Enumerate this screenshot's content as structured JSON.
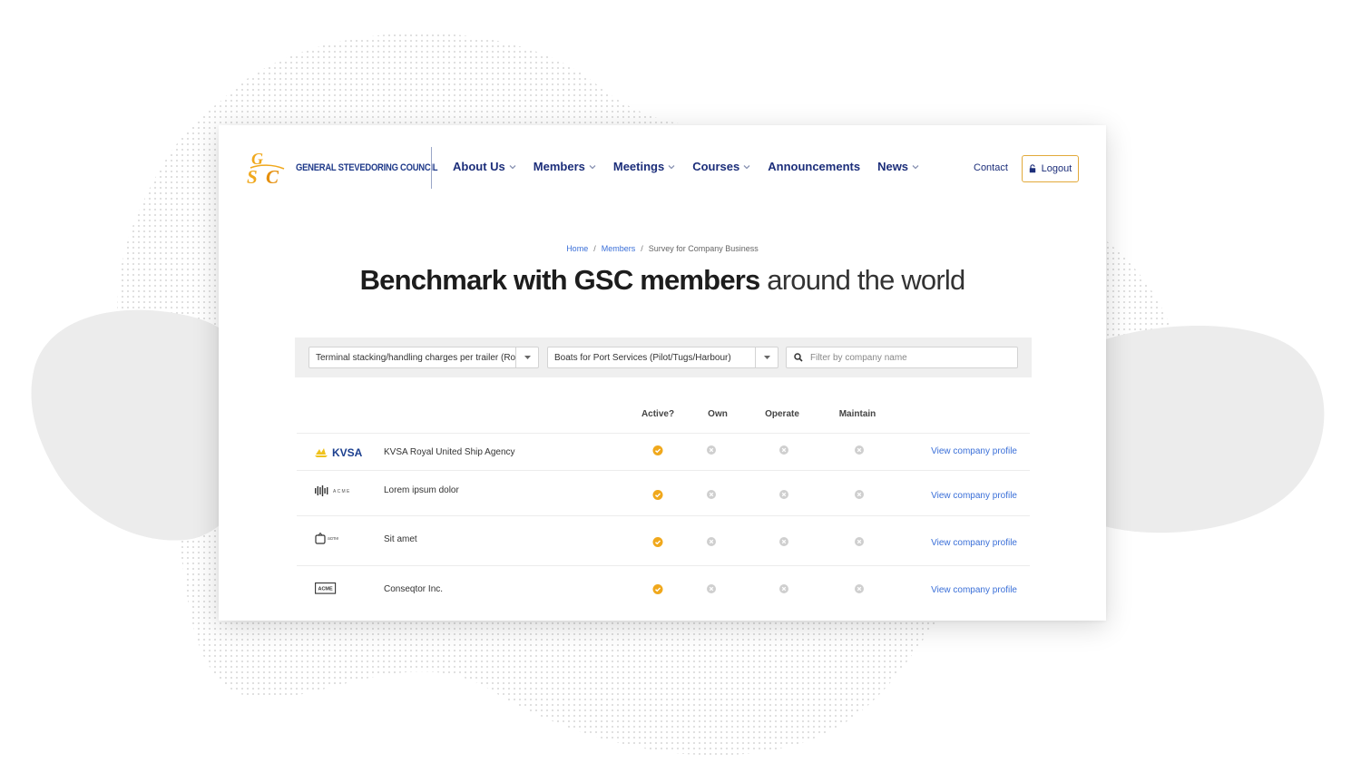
{
  "brand": {
    "name": "GENERAL STEVEDORING COUNCIL",
    "monogram": "GSC",
    "accent": "#f0a81c",
    "navy": "#1c2e7a"
  },
  "nav": {
    "items": [
      {
        "label": "About Us",
        "dropdown": true
      },
      {
        "label": "Members",
        "dropdown": true
      },
      {
        "label": "Meetings",
        "dropdown": true
      },
      {
        "label": "Courses",
        "dropdown": true
      },
      {
        "label": "Announcements",
        "dropdown": false
      },
      {
        "label": "News",
        "dropdown": true
      }
    ],
    "contact": "Contact",
    "logout": "Logout"
  },
  "breadcrumb": {
    "home": "Home",
    "members": "Members",
    "current": "Survey for Company Business",
    "separator": "/"
  },
  "title": {
    "bold": "Benchmark with GSC members",
    "light": "around the world"
  },
  "filters": {
    "select_1": "Terminal stacking/handling charges per trailer (Ro",
    "select_2": "Boats for Port Services (Pilot/Tugs/Harbour)",
    "search_placeholder": "Filter by company name"
  },
  "table": {
    "columns": [
      "Active?",
      "Own",
      "Operate",
      "Maintain"
    ],
    "rows": [
      {
        "logo": "KVSA",
        "company": "KVSA Royal United Ship Agency",
        "active": true,
        "own": false,
        "operate": false,
        "maintain": false,
        "link": "View company profile"
      },
      {
        "logo": "ACME",
        "company": "Lorem ipsum dolor",
        "active": true,
        "own": false,
        "operate": false,
        "maintain": false,
        "link": "View company profile"
      },
      {
        "logo": "acme",
        "company": "Sit amet",
        "active": true,
        "own": false,
        "operate": false,
        "maintain": false,
        "link": "View company profile"
      },
      {
        "logo": "ACME",
        "company": "Conseqtor Inc.",
        "active": true,
        "own": false,
        "operate": false,
        "maintain": false,
        "link": "View company profile"
      }
    ]
  }
}
